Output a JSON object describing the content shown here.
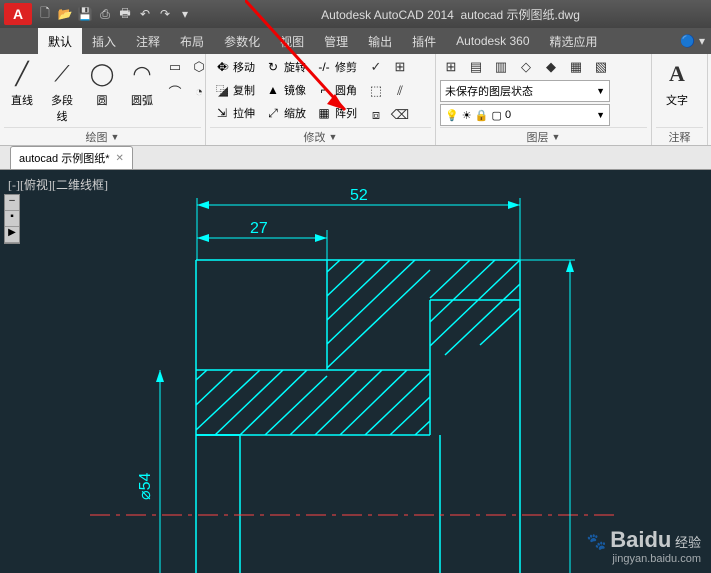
{
  "title": {
    "app": "Autodesk AutoCAD 2014",
    "file": "autocad 示例图纸.dwg"
  },
  "qat_icons": [
    "new",
    "open",
    "save",
    "save-as",
    "plot",
    "undo",
    "redo",
    "custom"
  ],
  "menu": {
    "tabs": [
      "默认",
      "插入",
      "注释",
      "布局",
      "参数化",
      "视图",
      "管理",
      "输出",
      "插件",
      "Autodesk 360",
      "精选应用"
    ],
    "active": 0
  },
  "panels": {
    "draw": {
      "title": "绘图",
      "big": [
        {
          "label": "直线",
          "icon": "/"
        },
        {
          "label": "多段线",
          "icon": "⟋"
        },
        {
          "label": "圆",
          "icon": "◯"
        },
        {
          "label": "圆弧",
          "icon": "◠"
        }
      ],
      "small": [
        "▭",
        "⬡",
        "⬭",
        "⌒",
        "◔",
        "◢"
      ]
    },
    "modify": {
      "title": "修改",
      "rows": [
        [
          {
            "ic": "✥",
            "label": "移动"
          },
          {
            "ic": "↻",
            "label": "旋转"
          },
          {
            "ic": "-/-",
            "label": "修剪"
          },
          {
            "ic": "▾",
            "label": ""
          }
        ],
        [
          {
            "ic": "⿻",
            "label": "复制"
          },
          {
            "ic": "▲",
            "label": "镜像"
          },
          {
            "ic": "⌐",
            "label": "圆角"
          },
          {
            "ic": "▾",
            "label": ""
          }
        ],
        [
          {
            "ic": "⇲",
            "label": "拉伸"
          },
          {
            "ic": "⤢",
            "label": "缩放"
          },
          {
            "ic": "▦",
            "label": "阵列"
          },
          {
            "ic": "▾",
            "label": ""
          }
        ]
      ],
      "side": [
        "✓",
        "⊞",
        "⬚",
        "⫽",
        "⧈",
        "⌫"
      ]
    },
    "layer": {
      "title": "图层",
      "top_icons": [
        "⊞",
        "▤",
        "▥",
        "◇",
        "◆",
        "▦",
        "▧"
      ],
      "combo": "未保存的图层状态",
      "status_icons": [
        "💡",
        "☀",
        "🔒",
        "▢",
        "0"
      ]
    },
    "annot": {
      "title": "注释",
      "big": [
        {
          "label": "文字",
          "icon": "A"
        }
      ]
    }
  },
  "doc_tab": {
    "name": "autocad 示例图纸*"
  },
  "viewport_label": "[-][俯视][二维线框]",
  "dims": {
    "d52": "52",
    "d27": "27",
    "d54": "⌀54"
  },
  "watermark": {
    "brand": "Baidu",
    "suffix": "经验",
    "url": "jingyan.baidu.com"
  }
}
